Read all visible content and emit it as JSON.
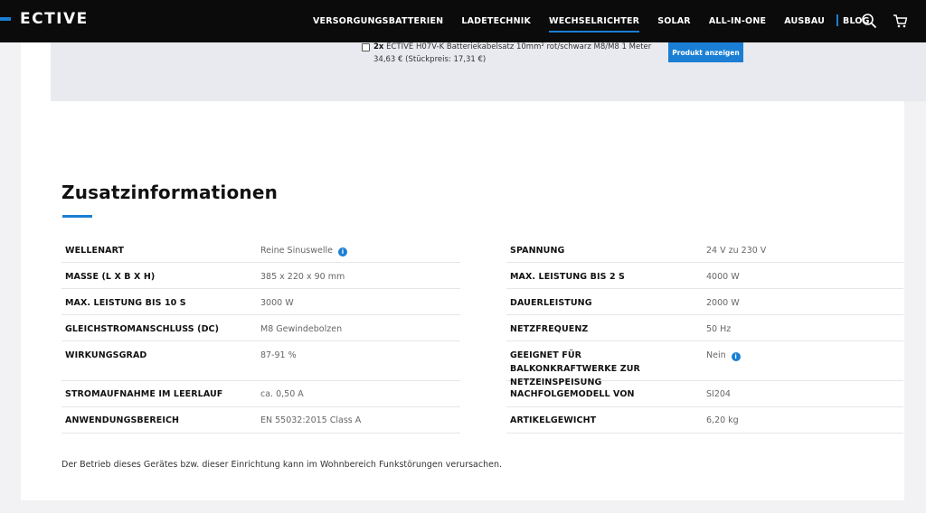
{
  "header": {
    "logo": "ECTIVE",
    "nav": [
      {
        "label": "VERSORGUNGSBATTERIEN",
        "active": false
      },
      {
        "label": "LADETECHNIK",
        "active": false
      },
      {
        "label": "WECHSELRICHTER",
        "active": true
      },
      {
        "label": "SOLAR",
        "active": false
      },
      {
        "label": "ALL-IN-ONE",
        "active": false
      },
      {
        "label": "AUSBAU",
        "active": false
      },
      {
        "label": "BLOG",
        "active": false
      }
    ],
    "icons": [
      "search-icon",
      "cart-icon"
    ]
  },
  "product": {
    "qty": "2x",
    "name": "ECTIVE H07V-K Batteriekabelsatz 10mm² rot/schwarz M8/M8 1 Meter",
    "price": "34,63 € (Stückpreis: 17,31 €)",
    "button": "Produkt anzeigen"
  },
  "section": {
    "title": "Zusatzinformationen",
    "left": [
      {
        "label": "WELLENART",
        "value": "Reine Sinuswelle",
        "info": true
      },
      {
        "label": "MASSE (L X B X H)",
        "value": "385 x 220 x 90 mm",
        "info": false
      },
      {
        "label": "MAX. LEISTUNG BIS 10 S",
        "value": "3000 W",
        "info": false
      },
      {
        "label": "GLEICHSTROMANSCHLUSS (DC)",
        "value": "M8 Gewindebolzen",
        "info": false
      },
      {
        "label": "WIRKUNGSGRAD",
        "value": "87-91 %",
        "info": false
      },
      {
        "label": "STROMAUFNAHME IM LEERLAUF",
        "value": "ca. 0,50 A",
        "info": false
      },
      {
        "label": "ANWENDUNGSBEREICH",
        "value": "EN 55032:2015 Class A",
        "info": false
      }
    ],
    "right": [
      {
        "label": "SPANNUNG",
        "value": "24 V zu 230 V",
        "info": false
      },
      {
        "label": "MAX. LEISTUNG BIS 2 S",
        "value": "4000 W",
        "info": false
      },
      {
        "label": "DAUERLEISTUNG",
        "value": "2000 W",
        "info": false
      },
      {
        "label": "NETZFREQUENZ",
        "value": "50 Hz",
        "info": false
      },
      {
        "label": "GEEIGNET FÜR BALKONKRAFTWERKE ZUR NETZEINSPEISUNG",
        "value": "Nein",
        "info": true
      },
      {
        "label": "NACHFOLGEMODELL VON",
        "value": "SI204",
        "info": false
      },
      {
        "label": "ARTIKELGEWICHT",
        "value": "6,20 kg",
        "info": false
      }
    ],
    "note": "Der Betrieb dieses Gerätes bzw. dieser Einrichtung kann im Wohnbereich Funkstörungen verursachen."
  },
  "colors": {
    "accent": "#1a7fd4",
    "header_bg": "#0b0b0b",
    "panel_bg": "#e9eaef"
  }
}
